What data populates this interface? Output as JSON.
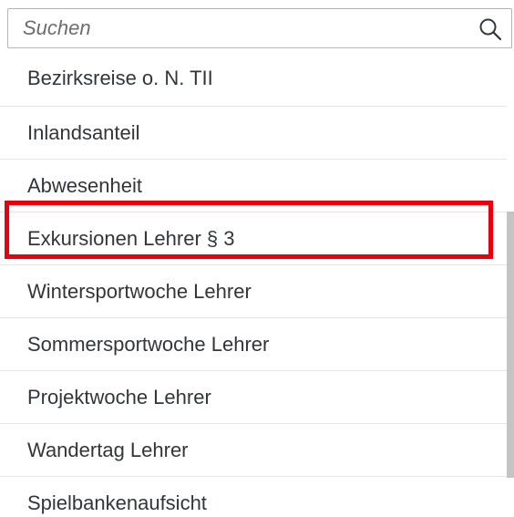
{
  "search": {
    "placeholder": "Suchen",
    "value": ""
  },
  "list": {
    "items": [
      {
        "label": "Bezirksreise o. N. TII"
      },
      {
        "label": "Inlandsanteil"
      },
      {
        "label": "Abwesenheit"
      },
      {
        "label": "Exkursionen Lehrer § 3",
        "highlighted": true
      },
      {
        "label": "Wintersportwoche Lehrer"
      },
      {
        "label": "Sommersportwoche Lehrer"
      },
      {
        "label": "Projektwoche Lehrer"
      },
      {
        "label": "Wandertag Lehrer"
      },
      {
        "label": "Spielbankenaufsicht"
      }
    ]
  },
  "colors": {
    "highlight_border": "#e8000d",
    "text": "#32363a",
    "placeholder": "#6a6d70",
    "divider": "#e5e5e5",
    "scrollbar": "#c4c4c4"
  }
}
